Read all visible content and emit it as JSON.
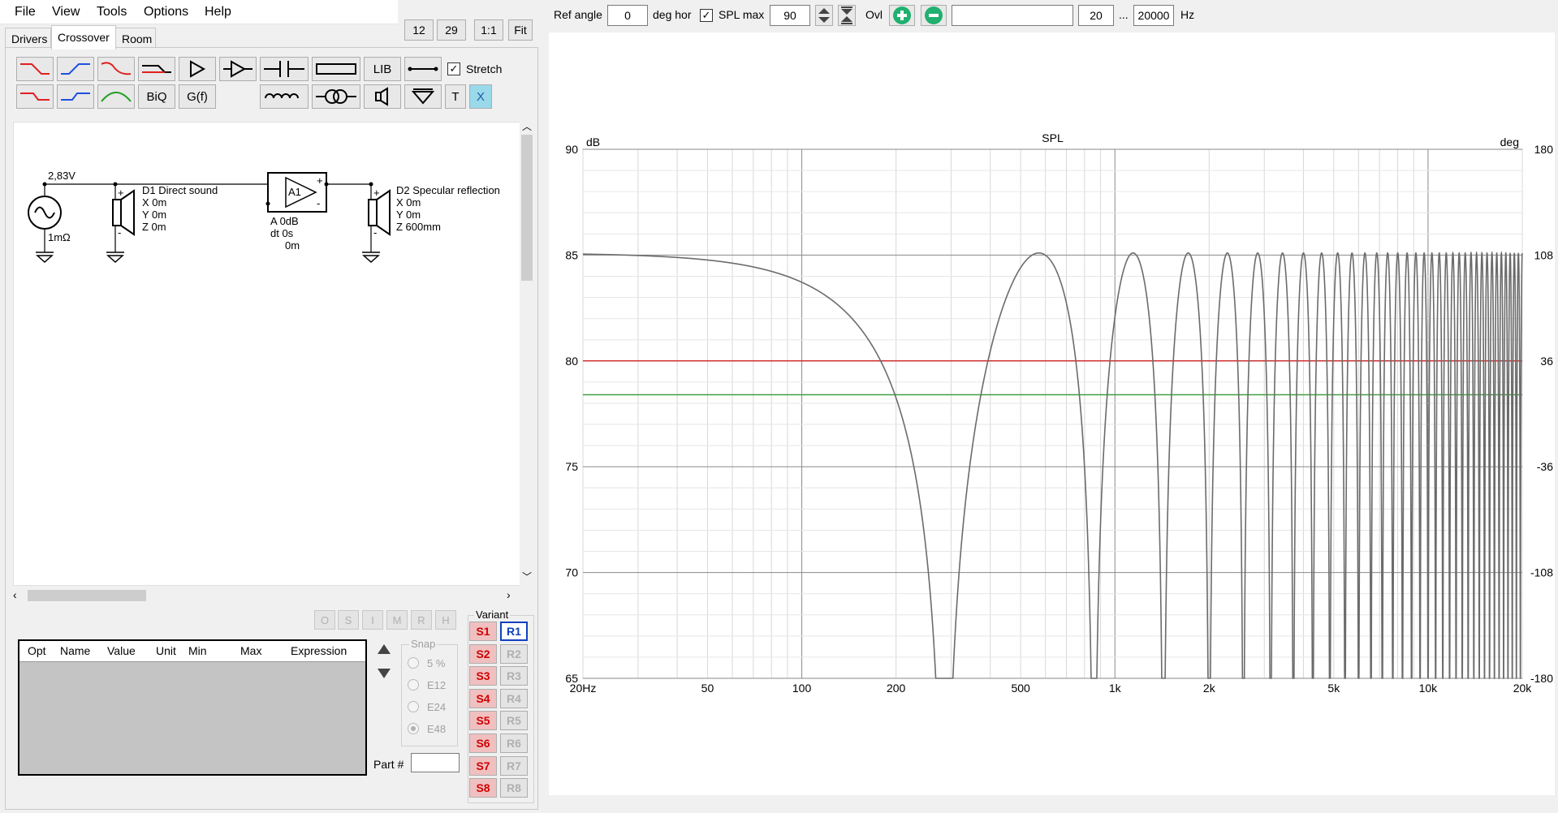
{
  "menu": [
    "File",
    "View",
    "Tools",
    "Options",
    "Help"
  ],
  "tabs": [
    "Drivers",
    "Crossover",
    "Room"
  ],
  "view_buttons": [
    "12",
    "29",
    "1:1",
    "Fit"
  ],
  "toolbar": {
    "biq": "BiQ",
    "gf": "G(f)",
    "lib": "LIB",
    "t": "T",
    "x": "X",
    "stretch": "Stretch"
  },
  "schematic": {
    "source_voltage": "2,83V",
    "source_resistance": "1mΩ",
    "d1": {
      "name": "D1 Direct sound",
      "x": "X 0m",
      "y": "Y 0m",
      "z": "Z 0m"
    },
    "amp": {
      "label": "A1",
      "gain": "A  0dB",
      "dt": "dt 0s",
      "dist": "0m"
    },
    "d2": {
      "name": "D2 Specular reflection",
      "x": "X 0m",
      "y": "Y 0m",
      "z": "Z 600mm"
    }
  },
  "opt_buttons": [
    "O",
    "S",
    "I",
    "M",
    "R",
    "H"
  ],
  "table_headers": [
    "Opt",
    "Name",
    "Value",
    "Unit",
    "Min",
    "Max",
    "Expression"
  ],
  "snap": {
    "title": "Snap",
    "options": [
      "5 %",
      "E12",
      "E24",
      "E48"
    ],
    "selected": "E48"
  },
  "part_label": "Part #",
  "variant": {
    "title": "Variant",
    "s": [
      "S1",
      "S2",
      "S3",
      "S4",
      "S5",
      "S6",
      "S7",
      "S8"
    ],
    "r": [
      "R1",
      "R2",
      "R3",
      "R4",
      "R5",
      "R6",
      "R7",
      "R8"
    ],
    "active_r": "R1"
  },
  "topbar": {
    "ref_angle_label": "Ref angle",
    "ref_angle": "0",
    "deg_hor": "deg hor",
    "spl_max_label": "SPL max",
    "spl_max": "90",
    "ovl": "Ovl",
    "freq_min": "20",
    "ellipsis": "...",
    "freq_max": "20000",
    "hz": "Hz"
  },
  "chart_data": {
    "type": "line",
    "title": "SPL",
    "ylabel": "dB",
    "y2label": "deg",
    "ylim": [
      65,
      90
    ],
    "y2lim": [
      -180,
      180
    ],
    "xscale": "log",
    "xlim": [
      20,
      20000
    ],
    "yticks": [
      "90",
      "85",
      "80",
      "75",
      "70",
      "65"
    ],
    "y2ticks": [
      "180",
      "108",
      "36",
      "-36",
      "-108",
      "-180"
    ],
    "xticks": [
      "20Hz",
      "50",
      "100",
      "200",
      "500",
      "1k",
      "2k",
      "5k",
      "10k",
      "20k"
    ],
    "series": [
      {
        "color": "#6b6b6b",
        "description": "comb-filter SPL: direct sound plus specular reflection, 0.6 m path difference",
        "peak_db": 85.1,
        "path_difference_m": 0.6
      },
      {
        "color": "#d03030",
        "constant_db": 80.0
      },
      {
        "color": "#40a040",
        "constant_db": 78.4
      }
    ]
  }
}
